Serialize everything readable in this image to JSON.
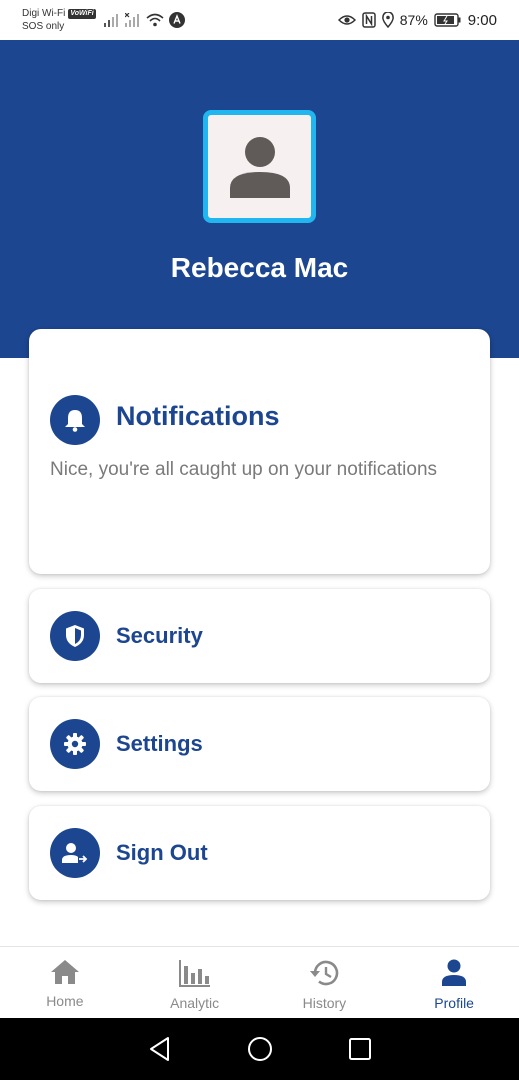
{
  "status_bar": {
    "carrier": "Digi Wi-Fi",
    "vowifi_badge": "VoWiFi",
    "sos": "SOS only",
    "battery_pct": "87%",
    "time": "9:00"
  },
  "profile": {
    "name": "Rebecca Mac"
  },
  "notifications": {
    "title": "Notifications",
    "description": "Nice, you're all caught up on your notifications",
    "icon": "bell-icon"
  },
  "menu": {
    "security": {
      "label": "Security",
      "icon": "shield-icon"
    },
    "settings": {
      "label": "Settings",
      "icon": "gear-icon"
    },
    "signout": {
      "label": "Sign Out",
      "icon": "sign-out-user-icon"
    }
  },
  "bottom_nav": {
    "items": [
      {
        "label": "Home",
        "icon": "home-icon",
        "active": false
      },
      {
        "label": "Analytic",
        "icon": "bar-chart-icon",
        "active": false
      },
      {
        "label": "History",
        "icon": "history-icon",
        "active": false
      },
      {
        "label": "Profile",
        "icon": "person-icon",
        "active": true
      }
    ]
  },
  "colors": {
    "primary": "#1c4690",
    "avatar_border": "#21b6f0",
    "inactive_nav": "#8a8a8a"
  }
}
